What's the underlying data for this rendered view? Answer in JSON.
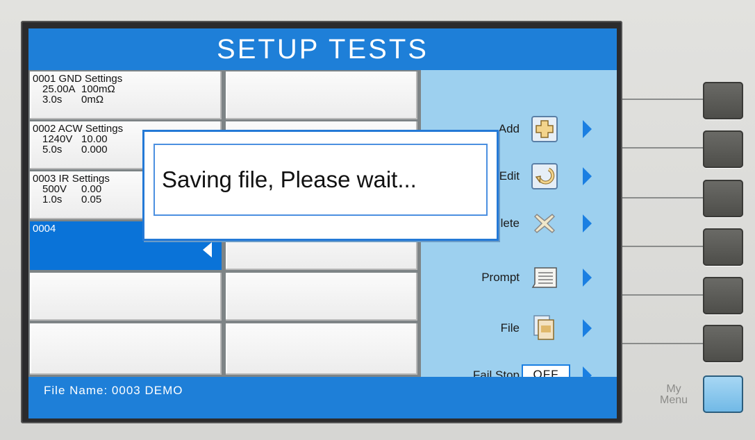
{
  "screen": {
    "title": "SETUP TESTS",
    "status_bar": "File Name:  0003  DEMO"
  },
  "steps": [
    {
      "header": "0001  GND  Settings",
      "line1_a": "25.00A",
      "line1_b": "100mΩ",
      "line2_a": "3.0s",
      "line2_b": "0mΩ"
    },
    {
      "header": "0002  ACW  Settings",
      "line1_a": "1240V",
      "line1_b": "10.00",
      "line2_a": "5.0s",
      "line2_b": "0.000"
    },
    {
      "header": "0003  IR  Settings",
      "line1_a": "500V",
      "line1_b": "0.00",
      "line2_a": "1.0s",
      "line2_b": "0.05"
    },
    {
      "header": "0004",
      "selected": true
    }
  ],
  "menu": {
    "add": "Add",
    "edit": "Edit",
    "delete": "Delete",
    "prompt": "Prompt",
    "file": "File",
    "fail_stop": "Fail Stop",
    "fail_stop_value": "OFF"
  },
  "dialog": {
    "message": "Saving file, Please wait..."
  },
  "hardware": {
    "my_menu_line1": "My",
    "my_menu_line2": "Menu"
  },
  "colors": {
    "title_bar": "#1e7fd8",
    "menu_bg": "#9dd0ef",
    "selected_cell": "#0a73d8",
    "arrow": "#1a7fe2"
  }
}
